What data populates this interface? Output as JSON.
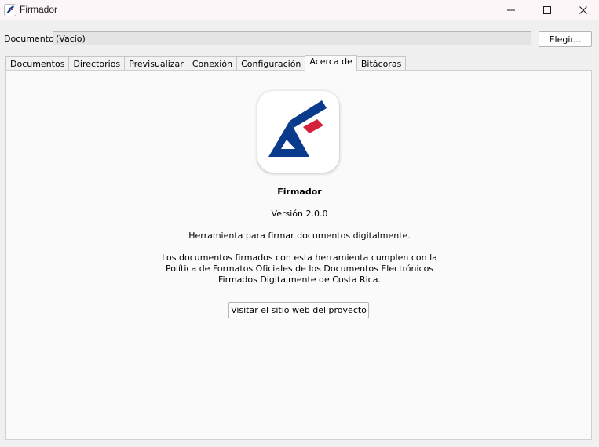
{
  "window": {
    "title": "Firmador",
    "icon": "firmador-app-icon"
  },
  "document_row": {
    "label": "Documento:",
    "value": "(Vacío)",
    "choose_label": "Elegir..."
  },
  "tabs": [
    {
      "label": "Documentos",
      "active": false
    },
    {
      "label": "Directorios",
      "active": false
    },
    {
      "label": "Previsualizar",
      "active": false
    },
    {
      "label": "Conexión",
      "active": false
    },
    {
      "label": "Configuración",
      "active": false
    },
    {
      "label": "Acerca de",
      "active": true
    },
    {
      "label": "Bitácoras",
      "active": false
    }
  ],
  "about": {
    "logo": "firmador-logo",
    "name": "Firmador",
    "version": "Versión 2.0.0",
    "description": "Herramienta para firmar documentos digitalmente.",
    "policy_lines": [
      "Los documentos firmados con esta herramienta cumplen con la",
      "Política de Formatos Oficiales de los Documentos Electrónicos",
      "Firmados Digitalmente de Costa Rica."
    ],
    "visit_label": "Visitar el sitio web del proyecto"
  },
  "colors": {
    "logo_blue": "#0a3a8c",
    "logo_red": "#d4213a"
  }
}
